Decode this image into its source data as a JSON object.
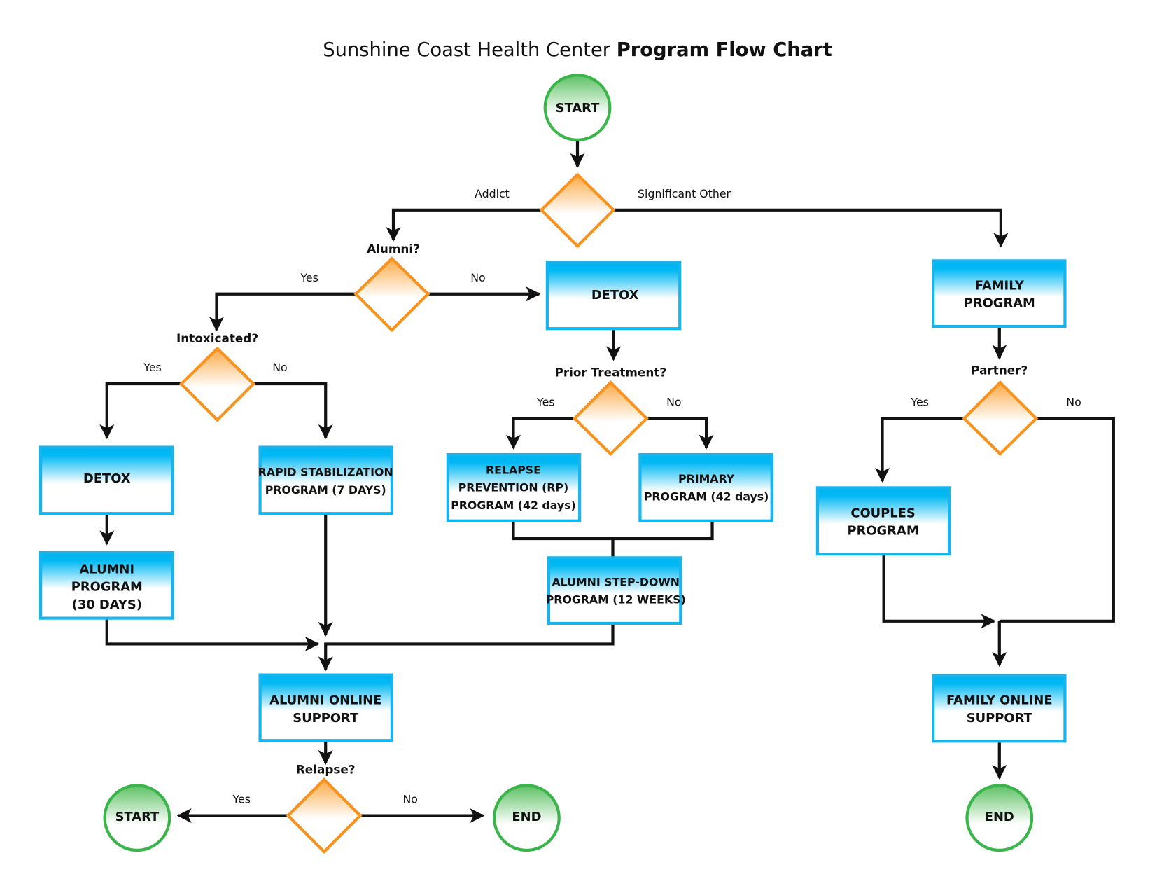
{
  "title": {
    "regular": "Sunshine Coast Health Center",
    "bold": "Program Flow Chart"
  },
  "colors": {
    "process_border": "#17b4ee",
    "process_fill_top": "#00b5f2",
    "decision_border": "#f7931e",
    "decision_fill_top": "#fbac4f",
    "terminal_border": "#3ab54a",
    "terminal_fill_top": "#5cc063",
    "connector": "#111111"
  },
  "nodes": {
    "start_top": {
      "type": "terminal",
      "lines": [
        "START"
      ]
    },
    "decision_root": {
      "type": "decision",
      "question": ""
    },
    "decision_alumni": {
      "type": "decision",
      "question": "Alumni?"
    },
    "detox_center": {
      "type": "process",
      "lines": [
        "DETOX"
      ]
    },
    "family_program": {
      "type": "process",
      "lines": [
        "FAMILY",
        "PROGRAM"
      ]
    },
    "decision_intoxicated": {
      "type": "decision",
      "question": "Intoxicated?"
    },
    "decision_prior_treatment": {
      "type": "decision",
      "question": "Prior Treatment?"
    },
    "decision_partner": {
      "type": "decision",
      "question": "Partner?"
    },
    "detox_left": {
      "type": "process",
      "lines": [
        "DETOX"
      ]
    },
    "rapid_stabilization": {
      "type": "process",
      "lines": [
        "RAPID STABILIZATION",
        "PROGRAM (7 DAYS)"
      ]
    },
    "relapse_prevention": {
      "type": "process",
      "lines": [
        "RELAPSE",
        "PREVENTION (RP)",
        "PROGRAM (42 days)"
      ]
    },
    "primary_program": {
      "type": "process",
      "lines": [
        "PRIMARY",
        "PROGRAM (42 days)"
      ]
    },
    "couples_program": {
      "type": "process",
      "lines": [
        "COUPLES",
        "PROGRAM"
      ]
    },
    "alumni_program": {
      "type": "process",
      "lines": [
        "ALUMNI",
        "PROGRAM",
        "(30 DAYS)"
      ]
    },
    "alumni_step_down": {
      "type": "process",
      "lines": [
        "ALUMNI STEP-DOWN",
        "PROGRAM (12 WEEKS)"
      ]
    },
    "alumni_online_support": {
      "type": "process",
      "lines": [
        "ALUMNI ONLINE",
        "SUPPORT"
      ]
    },
    "family_online_support": {
      "type": "process",
      "lines": [
        "FAMILY ONLINE",
        "SUPPORT"
      ]
    },
    "decision_relapse": {
      "type": "decision",
      "question": "Relapse?"
    },
    "start_bottom": {
      "type": "terminal",
      "lines": [
        "START"
      ]
    },
    "end_left": {
      "type": "terminal",
      "lines": [
        "END"
      ]
    },
    "end_right": {
      "type": "terminal",
      "lines": [
        "END"
      ]
    }
  },
  "edge_labels": {
    "addict": "Addict",
    "significant_other": "Significant Other",
    "alumni_yes": "Yes",
    "alumni_no": "No",
    "intoxicated_yes": "Yes",
    "intoxicated_no": "No",
    "prior_yes": "Yes",
    "prior_no": "No",
    "partner_yes": "Yes",
    "partner_no": "No",
    "relapse_yes": "Yes",
    "relapse_no": "No"
  }
}
